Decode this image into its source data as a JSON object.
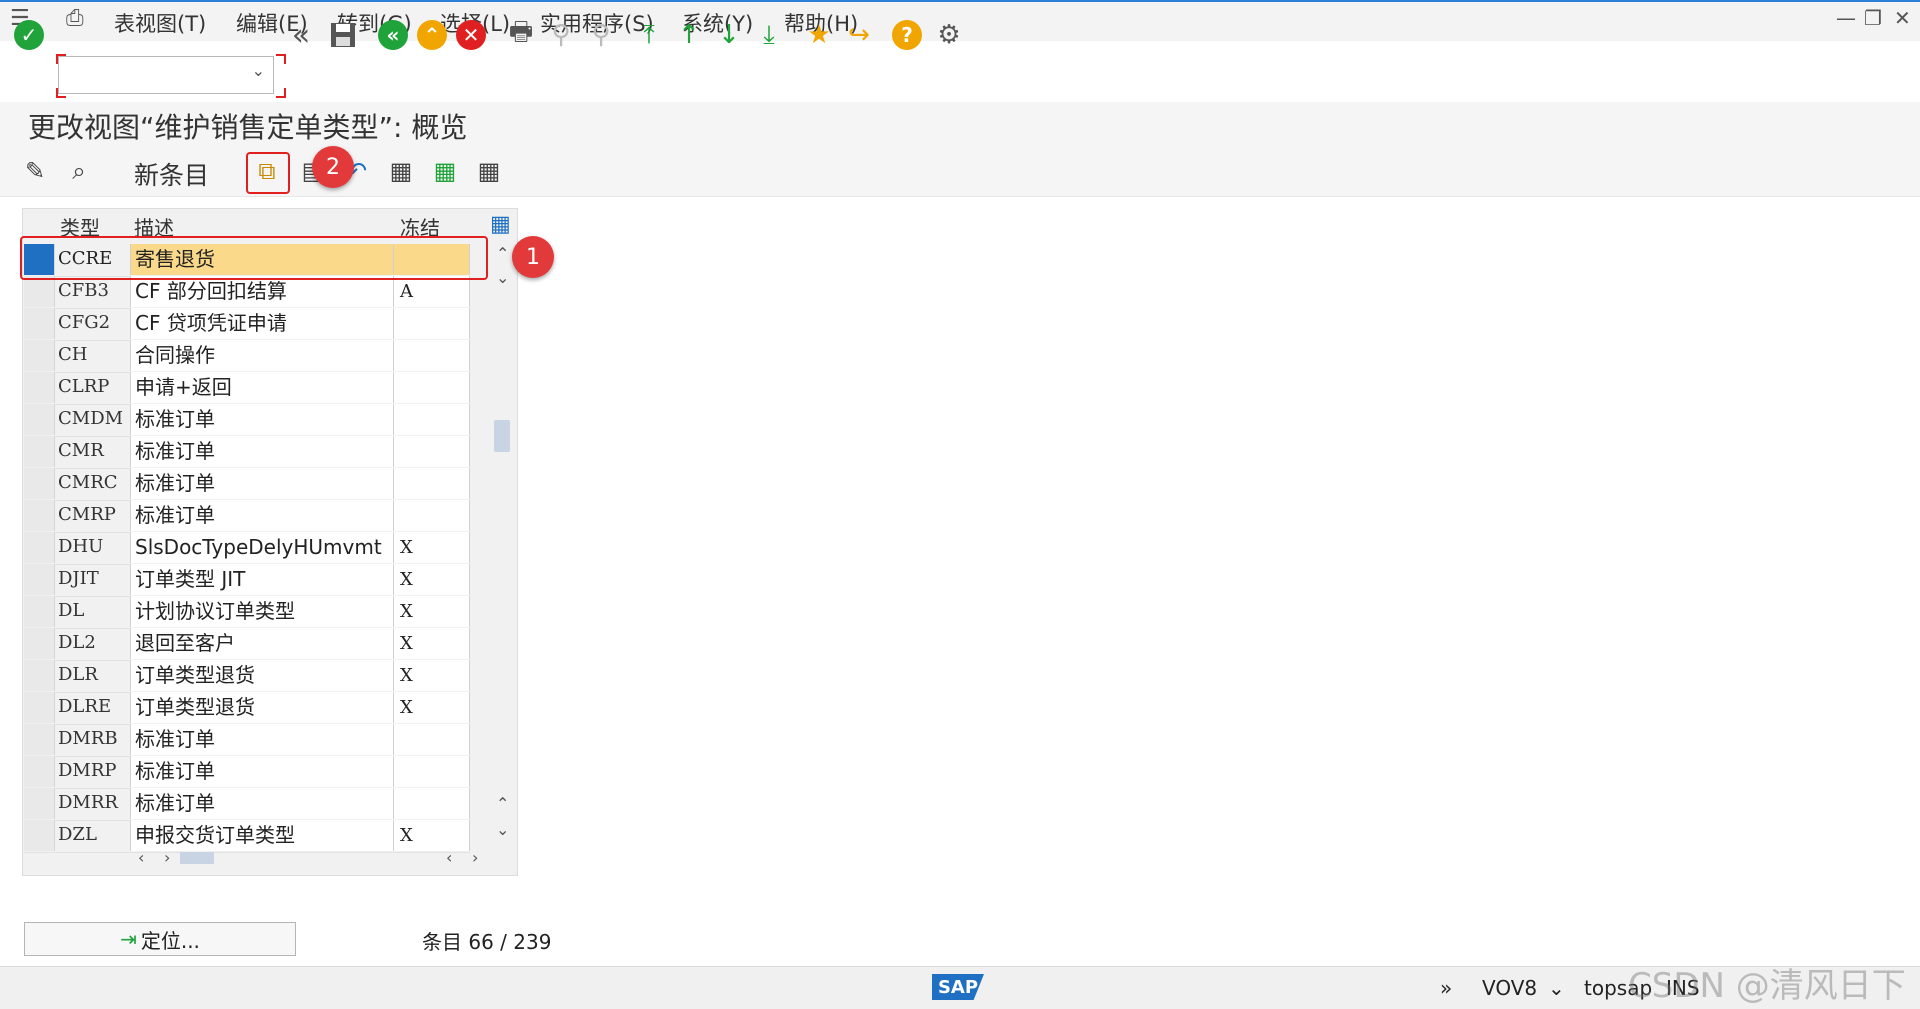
{
  "menu": {
    "items": [
      "表视图(T)",
      "编辑(E)",
      "转到(G)",
      "选择(L)",
      "实用程序(S)",
      "系统(Y)",
      "帮助(H)"
    ]
  },
  "toolbar": {
    "command_field_value": "",
    "icons": [
      "enter-icon",
      "back-double-icon",
      "save-icon",
      "back-icon",
      "exit-icon",
      "cancel-icon",
      "print-icon",
      "find-icon",
      "find-next-icon",
      "first-page-icon",
      "prev-page-icon",
      "next-page-icon",
      "last-page-icon",
      "create-session-icon",
      "shortcut-icon",
      "help-icon",
      "settings-icon"
    ]
  },
  "title": "更改视图“维护销售定单类型”: 概览",
  "app_toolbar": {
    "new_entries_label": "新条目"
  },
  "table": {
    "headers": {
      "type": "类型",
      "description": "描述",
      "frozen": "冻结"
    },
    "rows": [
      {
        "type": "CCRE",
        "description": "寄售退货",
        "frozen": "",
        "selected": true
      },
      {
        "type": "CFB3",
        "description": "CF 部分回扣结算",
        "frozen": "A"
      },
      {
        "type": "CFG2",
        "description": "CF 贷项凭证申请",
        "frozen": ""
      },
      {
        "type": "CH",
        "description": "合同操作",
        "frozen": ""
      },
      {
        "type": "CLRP",
        "description": "申请+返回",
        "frozen": ""
      },
      {
        "type": "CMDM",
        "description": "标准订单",
        "frozen": ""
      },
      {
        "type": "CMR",
        "description": "标准订单",
        "frozen": ""
      },
      {
        "type": "CMRC",
        "description": "标准订单",
        "frozen": ""
      },
      {
        "type": "CMRP",
        "description": "标准订单",
        "frozen": ""
      },
      {
        "type": "DHU",
        "description": "SlsDocTypeDelyHUmvmt",
        "frozen": "X"
      },
      {
        "type": "DJIT",
        "description": "订单类型 JIT",
        "frozen": "X"
      },
      {
        "type": "DL",
        "description": "计划协议订单类型",
        "frozen": "X"
      },
      {
        "type": "DL2",
        "description": "退回至客户",
        "frozen": "X"
      },
      {
        "type": "DLR",
        "description": "订单类型退货",
        "frozen": "X"
      },
      {
        "type": "DLRE",
        "description": "订单类型退货",
        "frozen": "X"
      },
      {
        "type": "DMRB",
        "description": "标准订单",
        "frozen": ""
      },
      {
        "type": "DMRP",
        "description": "标准订单",
        "frozen": ""
      },
      {
        "type": "DMRR",
        "description": "标准订单",
        "frozen": ""
      },
      {
        "type": "DZL",
        "description": "申报交货订单类型",
        "frozen": "X"
      }
    ]
  },
  "annotations": {
    "first": "1",
    "second": "2"
  },
  "bottom": {
    "position_button": "定位...",
    "entry_label": "条目",
    "entry_count": "66 / 239"
  },
  "status": {
    "transaction": "VOV8",
    "system": "topsap",
    "mode": "INS"
  },
  "watermark": "CSDN @清风日下",
  "colors": {
    "accent_blue": "#1f6fc2",
    "selected_row": "#fbd98a",
    "annotation_red": "#e23a3a"
  }
}
